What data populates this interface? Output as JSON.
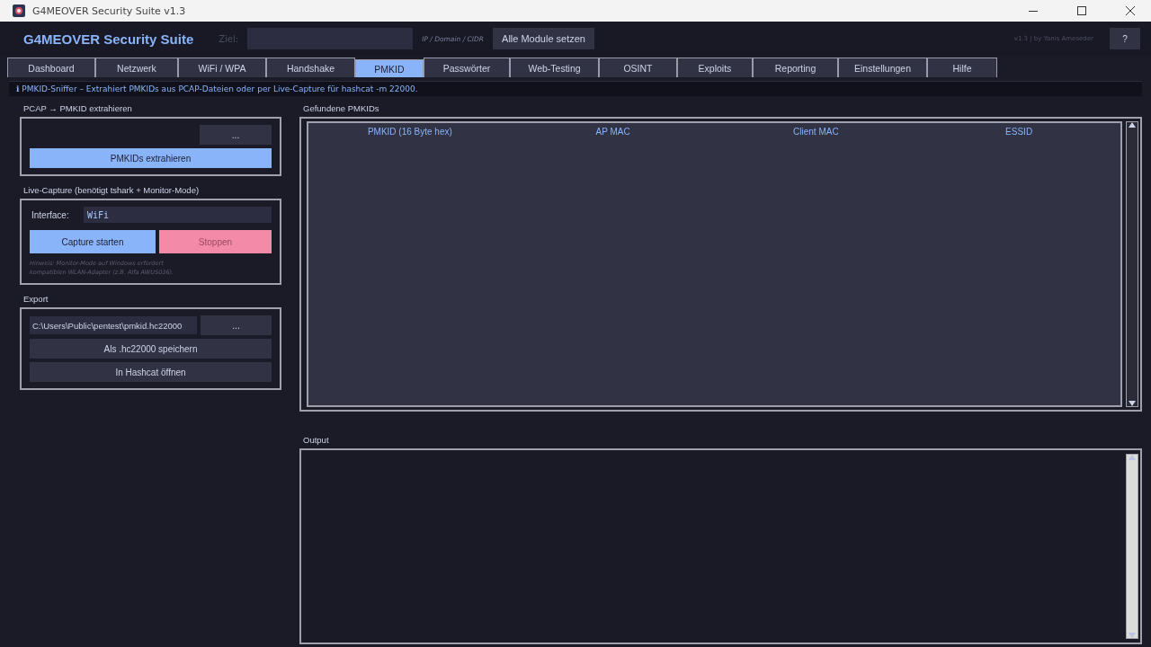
{
  "window": {
    "title": "G4MEOVER Security Suite  v1.3"
  },
  "header": {
    "app_name": "G4MEOVER Security Suite",
    "target_label": "Ziel:",
    "target_hint": "IP / Domain / CIDR",
    "set_all_button": "Alle Module setzen",
    "credit": "v1.3  |  by Yanis Ameseder",
    "help_button": "?"
  },
  "tabs": [
    {
      "label": "Dashboard",
      "selected": false
    },
    {
      "label": "Netzwerk",
      "selected": false
    },
    {
      "label": "WiFi / WPA",
      "selected": false
    },
    {
      "label": "Handshake",
      "selected": false
    },
    {
      "label": "PMKID",
      "selected": true
    },
    {
      "label": "Passwörter",
      "selected": false
    },
    {
      "label": "Web-Testing",
      "selected": false
    },
    {
      "label": "OSINT",
      "selected": false
    },
    {
      "label": "Exploits",
      "selected": false
    },
    {
      "label": "Reporting",
      "selected": false
    },
    {
      "label": "Einstellungen",
      "selected": false
    },
    {
      "label": "Hilfe",
      "selected": false
    }
  ],
  "info": {
    "icon": "ℹ",
    "text": "PMKID-Sniffer – Extrahiert PMKIDs aus PCAP-Dateien oder per Live-Capture für hashcat -m 22000."
  },
  "pcap": {
    "title": "PCAP → PMKID extrahieren",
    "browse_button": "...",
    "extract_button": "PMKIDs extrahieren"
  },
  "live": {
    "title": "Live-Capture (benötigt tshark + Monitor-Mode)",
    "interface_label": "Interface:",
    "interface_value": "WiFi",
    "start_button": "Capture starten",
    "stop_button": "Stoppen",
    "stop_disabled": true,
    "hint": "Hinweis: Monitor-Mode auf Windows erfordert\nkompatiblen WLAN-Adapter (z.B. Alfa AWUS036)."
  },
  "export": {
    "title": "Export",
    "path_value": "C:\\Users\\Public\\pentest\\pmkid.hc22000",
    "browse_button": "...",
    "save_button": "Als .hc22000 speichern",
    "hashcat_button": "In Hashcat öffnen"
  },
  "results": {
    "title": "Gefundene PMKIDs",
    "columns": [
      "PMKID (16 Byte hex)",
      "AP MAC",
      "Client MAC",
      "ESSID"
    ]
  },
  "output": {
    "title": "Output"
  }
}
